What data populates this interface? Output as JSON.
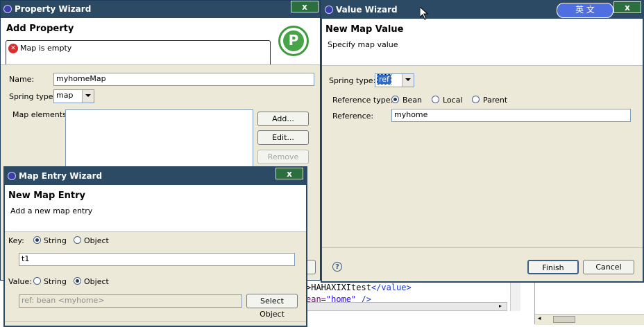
{
  "property_wizard": {
    "title": "Property Wizard",
    "close_label": "x",
    "heading": "Add Property",
    "error_message": "Map is empty",
    "logo_letter": "P",
    "name_label": "Name:",
    "name_value": "myhomeMap",
    "spring_type_label": "Spring type:",
    "spring_type_value": "map",
    "map_elements_label": "Map elements:",
    "add_label": "Add...",
    "edit_label": "Edit...",
    "remove_label": "Remove"
  },
  "value_wizard": {
    "title": "Value Wizard",
    "close_label": "x",
    "heading": "New Map Value",
    "subheading": "Specify map value",
    "spring_type_label": "Spring type:",
    "spring_type_value": "ref",
    "reference_type_label": "Reference type:",
    "reference_type_options": [
      "Bean",
      "Local",
      "Parent"
    ],
    "reference_type_selected": "Bean",
    "reference_label": "Reference:",
    "reference_value": "myhome",
    "finish_label": "Finish",
    "cancel_label": "Cancel",
    "ime_text": "英 文"
  },
  "map_entry_wizard": {
    "title": "Map Entry Wizard",
    "close_label": "x",
    "heading": "New Map Entry",
    "subheading": "Add a new map entry",
    "key_label": "Key:",
    "key_options": [
      "String",
      "Object"
    ],
    "key_selected": "String",
    "key_value": "t1",
    "value_label": "Value:",
    "value_options": [
      "String",
      "Object"
    ],
    "value_selected": "Object",
    "value_text": "ref: bean <myhome>",
    "select_object_label": "Select Object"
  },
  "editor": {
    "line1_prefix": ">",
    "line1_text": "HAHAXIXItest",
    "line1_tag": "</value>",
    "line2_attr": "ean=",
    "line2_value": "\"home\"",
    "line2_end": " />"
  },
  "colors": {
    "titlebar": "#2c4a64",
    "dialog_bg": "#ece9d8",
    "close_button": "#2b6f3f",
    "selection": "#316ac5"
  }
}
